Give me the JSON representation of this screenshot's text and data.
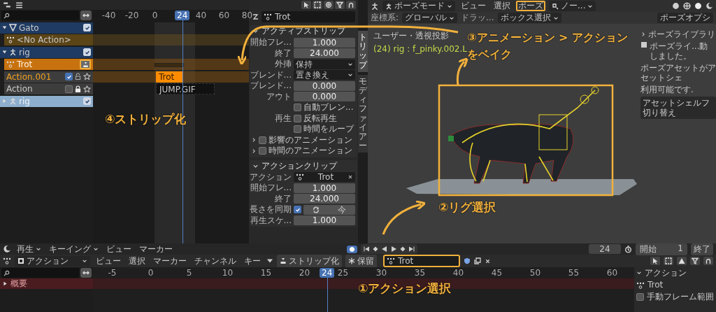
{
  "nla": {
    "ruler": [
      "-40",
      "-20",
      "0",
      "40",
      "60",
      "80"
    ],
    "current_frame": "24",
    "channels": [
      {
        "kind": "mesh_object",
        "label": "Gato",
        "expanded": true,
        "checked": true,
        "disabled": false
      },
      {
        "kind": "action",
        "label": "<No Action>"
      },
      {
        "kind": "armature_object",
        "label": "rig",
        "expanded": true,
        "checked": true,
        "disabled": false
      },
      {
        "kind": "active_action",
        "label": "Trot",
        "highlighted": true
      },
      {
        "kind": "track",
        "label": "Action.001",
        "selected": true,
        "checked": true,
        "locked": false,
        "strip": {
          "label": "Trot",
          "selected": true
        }
      },
      {
        "kind": "track",
        "label": "Action",
        "selected": false,
        "checked": false,
        "locked": true,
        "strip": {
          "label": "JUMP.GIF",
          "selected": false
        }
      },
      {
        "kind": "armature_object",
        "label": "rig",
        "expanded": false,
        "checked": true,
        "disabled": true
      }
    ]
  },
  "sidebar": {
    "action_field": "Trot",
    "panels": [
      {
        "title": "アクティブストリップ",
        "expanded": true,
        "rows": [
          {
            "kind": "number",
            "label": "開始フレ...",
            "value": "1.000"
          },
          {
            "kind": "number",
            "label": "終了",
            "value": "24.000"
          },
          {
            "kind": "dropdown",
            "label": "外挿",
            "value": "保持"
          },
          {
            "kind": "dropdown",
            "label": "ブレンド...",
            "value": "置き換え"
          },
          {
            "kind": "number",
            "label": "ブレンド...",
            "value": "0.000"
          },
          {
            "kind": "number",
            "label": "アウト",
            "value": "0.000"
          },
          {
            "kind": "checkbox",
            "text": "自動ブレン...",
            "checked": false
          },
          {
            "kind": "checkbox",
            "label": "再生",
            "text": "反転再生",
            "checked": false
          },
          {
            "kind": "checkbox",
            "text": "時間をループ",
            "checked": false
          },
          {
            "kind": "subpanel",
            "text": "影響のアニメーション",
            "checked": false
          },
          {
            "kind": "subpanel",
            "text": "時間のアニメーション",
            "checked": false
          }
        ]
      },
      {
        "title": "アクションクリップ",
        "expanded": true,
        "rows": [
          {
            "kind": "action",
            "label": "アクション",
            "value": "Trot"
          },
          {
            "kind": "number",
            "label": "開始フレ...",
            "value": "1.000"
          },
          {
            "kind": "number",
            "label": "終了",
            "value": "24.000"
          },
          {
            "kind": "sync",
            "label": "長さを同期",
            "checked": true,
            "button": "今"
          },
          {
            "kind": "number",
            "label": "再生スケ...",
            "value": "1.000"
          }
        ]
      }
    ],
    "tabs": [
      {
        "label": "トリップ",
        "selected": true
      },
      {
        "label": "モディファイアー",
        "selected": false
      }
    ]
  },
  "viewport": {
    "header": [
      {
        "kind": "mode",
        "label": "ポーズモード",
        "highlighted": false
      },
      {
        "kind": "menu",
        "label": "ビュー",
        "highlighted": false
      },
      {
        "kind": "menu",
        "label": "選択",
        "highlighted": false
      },
      {
        "kind": "menu",
        "label": "ポーズ",
        "highlighted": true
      },
      {
        "kind": "dropdown",
        "label": "ノー...",
        "highlighted": false
      }
    ],
    "tool_row": [
      {
        "kind": "text",
        "label": "座標系:"
      },
      {
        "kind": "dropdown",
        "label": "グローバル"
      },
      {
        "kind": "text",
        "label": "ドラッ..."
      },
      {
        "kind": "dropdown",
        "label": "ボックス選択"
      }
    ],
    "options": "ポーズオプシ",
    "overlay": [
      "ユーザー・透視投影",
      "(24) rig : f_pinky.002.L"
    ],
    "rig_highlighted": true,
    "pose_library": {
      "title": "ポーズライブラリ",
      "info": "ポーズライ...動しました。",
      "lines": [
        "ポーズアセットがアセットシェ",
        "利用可能です."
      ],
      "button": "アセットシェルフ切り替え"
    }
  },
  "timeline": {
    "menus": [
      {
        "label": "再生",
        "kind": "dropdown"
      },
      {
        "label": "キーイング",
        "kind": "dropdown"
      },
      {
        "label": "ビュー",
        "kind": "menu"
      },
      {
        "label": "マーカー",
        "kind": "menu"
      }
    ],
    "current": "24",
    "start_label": "開始",
    "start": "1",
    "end_label": "終了"
  },
  "dopesheet": {
    "mode": "アクション",
    "menus": [
      "ビュー",
      "選択",
      "マーカー",
      "チャンネル",
      "キー"
    ],
    "buttons": [
      {
        "label": "ストリップ化",
        "kind": "push_down"
      },
      {
        "label": "保留",
        "kind": "stash"
      }
    ],
    "action": "Trot",
    "action_highlighted": true,
    "ruler": [
      "-5",
      "0",
      "5",
      "10",
      "15",
      "20",
      "25",
      "30",
      "35",
      "40",
      "45",
      "50",
      "55",
      "60"
    ],
    "current_frame": "24",
    "rows": [
      {
        "label": "概要",
        "expanded": false
      }
    ],
    "sidebar": {
      "title": "アクション",
      "action": "Trot",
      "checkbox": {
        "label": "手動フレーム範囲",
        "checked": false
      }
    }
  },
  "annotations": [
    {
      "lines": [
        "③アニメーション > アクション",
        "をベイク"
      ]
    },
    {
      "lines": [
        "④ストリップ化"
      ]
    },
    {
      "lines": [
        "②リグ選択"
      ]
    },
    {
      "lines": [
        "①アクション選択"
      ]
    }
  ]
}
